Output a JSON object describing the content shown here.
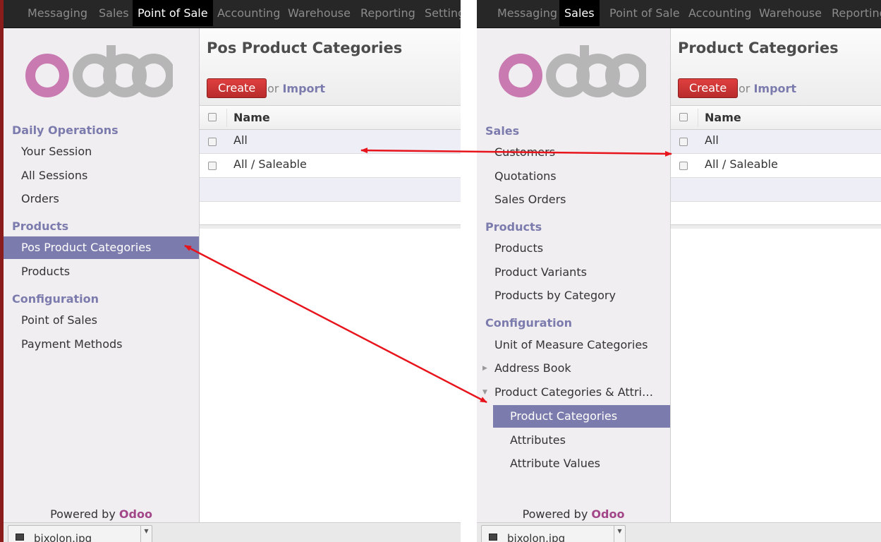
{
  "left": {
    "topbar": {
      "items": [
        "Messaging",
        "Sales",
        "Point of Sale",
        "Accounting",
        "Warehouse",
        "Reporting",
        "Setting"
      ],
      "active_index": 2
    },
    "logo_text": "odoo",
    "sidebar": {
      "sections": [
        {
          "title": "Daily Operations",
          "items": [
            "Your Session",
            "All Sessions",
            "Orders"
          ]
        },
        {
          "title": "Products",
          "items": [
            "Pos Product Categories",
            "Products"
          ]
        },
        {
          "title": "Configuration",
          "items": [
            "Point of Sales",
            "Payment Methods"
          ]
        }
      ],
      "active_item": "Pos Product Categories",
      "powered": "Powered by",
      "brand": "Odoo"
    },
    "main": {
      "title": "Pos Product Categories",
      "create_label": "Create",
      "or_label": "or",
      "import_label": "Import",
      "column_name": "Name",
      "rows": [
        "All",
        "All / Saleable"
      ]
    },
    "download": {
      "filename": "bixolon.jpg"
    }
  },
  "right": {
    "topbar": {
      "items": [
        "Messaging",
        "Sales",
        "Point of Sale",
        "Accounting",
        "Warehouse",
        "Reporting"
      ],
      "active_index": 1
    },
    "logo_text": "odoo",
    "sidebar": {
      "sections": [
        {
          "title": "Sales",
          "items": [
            "Customers",
            "Quotations",
            "Sales Orders"
          ]
        },
        {
          "title": "Products",
          "items": [
            "Products",
            "Product Variants",
            "Products by Category"
          ]
        },
        {
          "title": "Configuration",
          "items": [
            "Unit of Measure Categories",
            "Address Book",
            "Product Categories & Attri…",
            "Product Categories",
            "Attributes",
            "Attribute Values"
          ]
        }
      ],
      "active_item": "Product Categories",
      "powered": "Powered by",
      "brand": "Odoo"
    },
    "main": {
      "title": "Product Categories",
      "create_label": "Create",
      "or_label": "or",
      "import_label": "Import",
      "column_name": "Name",
      "rows": [
        "All",
        "All / Saleable"
      ]
    },
    "download": {
      "filename": "bixolon.jpg"
    }
  },
  "colors": {
    "accent": "#7c7bad",
    "brand": "#a24689",
    "create": "#c9302c",
    "arrow": "#e8141c",
    "topbar": "#272727"
  }
}
